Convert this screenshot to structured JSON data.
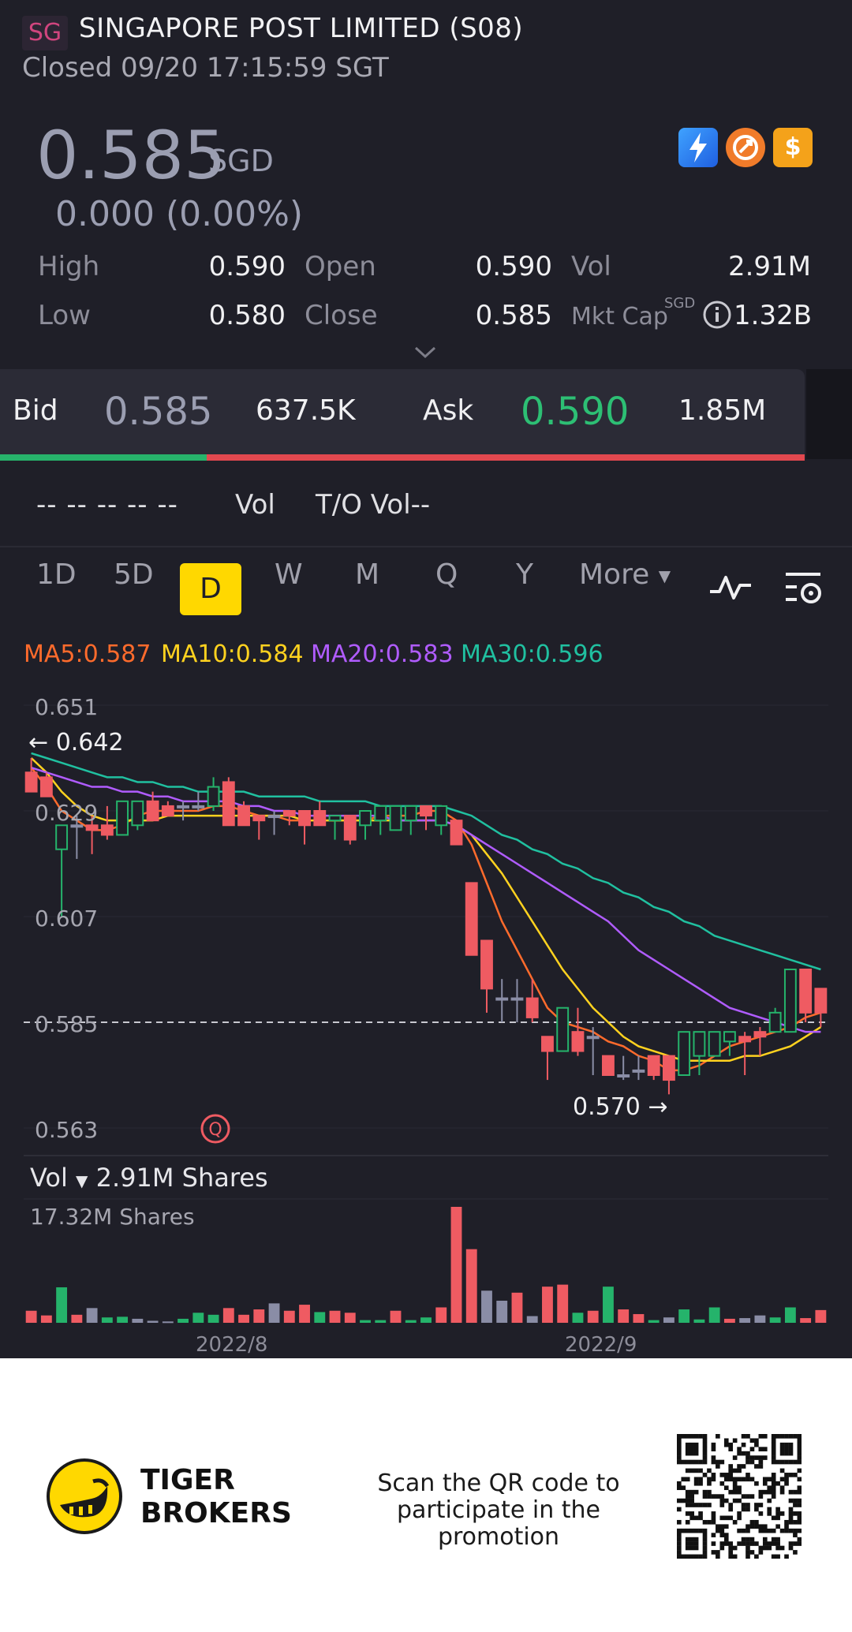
{
  "header": {
    "badge": "SG",
    "title": "SINGAPORE POST LIMITED (S08)",
    "status": "Closed 09/20 17:15:59 SGT"
  },
  "quote": {
    "price": "0.585",
    "currency": "SGD",
    "change": "0.000 (0.00%)",
    "badges": [
      "lightning-icon",
      "rocket-icon",
      "dollar-icon"
    ]
  },
  "stats": {
    "high_label": "High",
    "high": "0.590",
    "open_label": "Open",
    "open": "0.590",
    "vol_label": "Vol",
    "vol": "2.91M",
    "low_label": "Low",
    "low": "0.580",
    "close_label": "Close",
    "close": "0.585",
    "mktcap_label": "Mkt Cap",
    "mktcap_currency": "SGD",
    "mktcap": "1.32B"
  },
  "bidask": {
    "bid_label": "Bid",
    "bid": "0.585",
    "bid_size": "637.5K",
    "ask_label": "Ask",
    "ask": "0.590",
    "ask_size": "1.85M",
    "bid_fraction": 0.257
  },
  "volrow": {
    "placeholders": "-- -- -- -- --",
    "vol_label": "Vol",
    "to_vol_label": "T/O Vol--"
  },
  "timeframes": {
    "items": [
      "1D",
      "5D",
      "D",
      "W",
      "M",
      "Q",
      "Y"
    ],
    "active": "D",
    "more": "More"
  },
  "ma": {
    "ma5": "MA5:0.587",
    "ma10": "MA10:0.584",
    "ma20": "MA20:0.583",
    "ma30": "MA30:0.596",
    "colors": {
      "ma5": "#ff6b2c",
      "ma10": "#ffd21f",
      "ma20": "#b05cff",
      "ma30": "#20c0a0"
    }
  },
  "chart_annotations": {
    "max_label": "0.642",
    "min_label": "0.570",
    "volume_selector": "Vol",
    "volume_current": "2.91M Shares",
    "volume_max": "17.32M Shares"
  },
  "chart_data": {
    "type": "candlestick",
    "y_ticks": [
      "0.651",
      "0.629",
      "0.607",
      "0.585",
      "0.563"
    ],
    "ylim": [
      0.563,
      0.651
    ],
    "x_ticks": [
      "2022/8",
      "2022/9"
    ],
    "current_price_line": 0.585,
    "up_color": "#25b36b",
    "down_color": "#ef5b62",
    "flat_color": "#8a8da6",
    "candles": [
      {
        "o": 0.637,
        "h": 0.64,
        "l": 0.633,
        "c": 0.633
      },
      {
        "o": 0.636,
        "h": 0.637,
        "l": 0.632,
        "c": 0.632
      },
      {
        "o": 0.621,
        "h": 0.626,
        "l": 0.607,
        "c": 0.626
      },
      {
        "o": 0.626,
        "h": 0.628,
        "l": 0.619,
        "c": 0.626
      },
      {
        "o": 0.626,
        "h": 0.628,
        "l": 0.62,
        "c": 0.625
      },
      {
        "o": 0.626,
        "h": 0.63,
        "l": 0.623,
        "c": 0.624
      },
      {
        "o": 0.624,
        "h": 0.631,
        "l": 0.624,
        "c": 0.631
      },
      {
        "o": 0.626,
        "h": 0.631,
        "l": 0.625,
        "c": 0.631
      },
      {
        "o": 0.631,
        "h": 0.633,
        "l": 0.627,
        "c": 0.627
      },
      {
        "o": 0.63,
        "h": 0.631,
        "l": 0.628,
        "c": 0.628
      },
      {
        "o": 0.63,
        "h": 0.631,
        "l": 0.627,
        "c": 0.63
      },
      {
        "o": 0.63,
        "h": 0.633,
        "l": 0.629,
        "c": 0.63
      },
      {
        "o": 0.63,
        "h": 0.636,
        "l": 0.629,
        "c": 0.634
      },
      {
        "o": 0.635,
        "h": 0.636,
        "l": 0.626,
        "c": 0.626
      },
      {
        "o": 0.63,
        "h": 0.631,
        "l": 0.626,
        "c": 0.626
      },
      {
        "o": 0.628,
        "h": 0.628,
        "l": 0.623,
        "c": 0.627
      },
      {
        "o": 0.628,
        "h": 0.629,
        "l": 0.624,
        "c": 0.628
      },
      {
        "o": 0.629,
        "h": 0.629,
        "l": 0.626,
        "c": 0.628
      },
      {
        "o": 0.629,
        "h": 0.629,
        "l": 0.622,
        "c": 0.626
      },
      {
        "o": 0.629,
        "h": 0.631,
        "l": 0.626,
        "c": 0.626
      },
      {
        "o": 0.627,
        "h": 0.628,
        "l": 0.623,
        "c": 0.628
      },
      {
        "o": 0.628,
        "h": 0.628,
        "l": 0.622,
        "c": 0.623
      },
      {
        "o": 0.626,
        "h": 0.629,
        "l": 0.623,
        "c": 0.629
      },
      {
        "o": 0.627,
        "h": 0.63,
        "l": 0.624,
        "c": 0.63
      },
      {
        "o": 0.625,
        "h": 0.63,
        "l": 0.625,
        "c": 0.63
      },
      {
        "o": 0.627,
        "h": 0.63,
        "l": 0.624,
        "c": 0.63
      },
      {
        "o": 0.63,
        "h": 0.63,
        "l": 0.625,
        "c": 0.628
      },
      {
        "o": 0.626,
        "h": 0.63,
        "l": 0.624,
        "c": 0.63
      },
      {
        "o": 0.627,
        "h": 0.627,
        "l": 0.622,
        "c": 0.622
      },
      {
        "o": 0.614,
        "h": 0.614,
        "l": 0.599,
        "c": 0.599
      },
      {
        "o": 0.602,
        "h": 0.602,
        "l": 0.587,
        "c": 0.592
      },
      {
        "o": 0.59,
        "h": 0.594,
        "l": 0.585,
        "c": 0.59
      },
      {
        "o": 0.59,
        "h": 0.594,
        "l": 0.585,
        "c": 0.59
      },
      {
        "o": 0.59,
        "h": 0.594,
        "l": 0.585,
        "c": 0.586
      },
      {
        "o": 0.582,
        "h": 0.582,
        "l": 0.573,
        "c": 0.579
      },
      {
        "o": 0.579,
        "h": 0.588,
        "l": 0.579,
        "c": 0.588
      },
      {
        "o": 0.583,
        "h": 0.588,
        "l": 0.578,
        "c": 0.579
      },
      {
        "o": 0.582,
        "h": 0.584,
        "l": 0.574,
        "c": 0.582
      },
      {
        "o": 0.578,
        "h": 0.578,
        "l": 0.574,
        "c": 0.574
      },
      {
        "o": 0.574,
        "h": 0.578,
        "l": 0.573,
        "c": 0.574
      },
      {
        "o": 0.575,
        "h": 0.578,
        "l": 0.573,
        "c": 0.575
      },
      {
        "o": 0.578,
        "h": 0.578,
        "l": 0.573,
        "c": 0.574
      },
      {
        "o": 0.578,
        "h": 0.578,
        "l": 0.57,
        "c": 0.573
      },
      {
        "o": 0.574,
        "h": 0.583,
        "l": 0.574,
        "c": 0.583
      },
      {
        "o": 0.578,
        "h": 0.583,
        "l": 0.574,
        "c": 0.583
      },
      {
        "o": 0.578,
        "h": 0.583,
        "l": 0.578,
        "c": 0.583
      },
      {
        "o": 0.581,
        "h": 0.583,
        "l": 0.578,
        "c": 0.583
      },
      {
        "o": 0.582,
        "h": 0.583,
        "l": 0.574,
        "c": 0.581
      },
      {
        "o": 0.583,
        "h": 0.584,
        "l": 0.578,
        "c": 0.582
      },
      {
        "o": 0.583,
        "h": 0.588,
        "l": 0.583,
        "c": 0.587
      },
      {
        "o": 0.583,
        "h": 0.596,
        "l": 0.583,
        "c": 0.596
      },
      {
        "o": 0.596,
        "h": 0.596,
        "l": 0.585,
        "c": 0.587
      },
      {
        "o": 0.592,
        "h": 0.592,
        "l": 0.584,
        "c": 0.587
      }
    ],
    "ma_series": {
      "MA5": [
        0.638,
        0.634,
        0.629,
        0.627,
        0.625,
        0.625,
        0.626,
        0.628,
        0.629,
        0.629,
        0.629,
        0.629,
        0.63,
        0.63,
        0.629,
        0.628,
        0.628,
        0.627,
        0.627,
        0.627,
        0.627,
        0.627,
        0.627,
        0.628,
        0.628,
        0.628,
        0.629,
        0.629,
        0.627,
        0.622,
        0.614,
        0.606,
        0.6,
        0.594,
        0.588,
        0.585,
        0.584,
        0.583,
        0.581,
        0.58,
        0.578,
        0.577,
        0.575,
        0.575,
        0.576,
        0.578,
        0.58,
        0.581,
        0.582,
        0.583,
        0.584,
        0.586,
        0.587
      ],
      "MA10": [
        0.64,
        0.637,
        0.633,
        0.63,
        0.628,
        0.627,
        0.627,
        0.627,
        0.627,
        0.628,
        0.628,
        0.628,
        0.628,
        0.628,
        0.628,
        0.628,
        0.628,
        0.628,
        0.627,
        0.627,
        0.627,
        0.627,
        0.627,
        0.627,
        0.627,
        0.627,
        0.627,
        0.627,
        0.626,
        0.624,
        0.62,
        0.616,
        0.611,
        0.606,
        0.601,
        0.596,
        0.592,
        0.588,
        0.585,
        0.582,
        0.58,
        0.579,
        0.578,
        0.577,
        0.577,
        0.577,
        0.577,
        0.578,
        0.578,
        0.579,
        0.58,
        0.582,
        0.584
      ],
      "MA20": [
        0.638,
        0.637,
        0.636,
        0.635,
        0.634,
        0.634,
        0.633,
        0.633,
        0.632,
        0.632,
        0.631,
        0.631,
        0.631,
        0.631,
        0.63,
        0.63,
        0.629,
        0.629,
        0.628,
        0.628,
        0.628,
        0.628,
        0.628,
        0.628,
        0.627,
        0.627,
        0.627,
        0.627,
        0.626,
        0.624,
        0.622,
        0.62,
        0.618,
        0.616,
        0.614,
        0.612,
        0.61,
        0.608,
        0.606,
        0.603,
        0.6,
        0.598,
        0.596,
        0.594,
        0.592,
        0.59,
        0.588,
        0.587,
        0.586,
        0.585,
        0.584,
        0.583,
        0.583
      ],
      "MA30": [
        0.641,
        0.64,
        0.639,
        0.638,
        0.637,
        0.636,
        0.636,
        0.635,
        0.635,
        0.634,
        0.634,
        0.633,
        0.633,
        0.633,
        0.633,
        0.632,
        0.632,
        0.632,
        0.632,
        0.631,
        0.631,
        0.631,
        0.631,
        0.63,
        0.63,
        0.63,
        0.63,
        0.63,
        0.629,
        0.628,
        0.626,
        0.624,
        0.623,
        0.621,
        0.62,
        0.618,
        0.617,
        0.615,
        0.614,
        0.612,
        0.611,
        0.609,
        0.608,
        0.606,
        0.605,
        0.603,
        0.602,
        0.601,
        0.6,
        0.599,
        0.598,
        0.597,
        0.596
      ]
    },
    "volume": {
      "max": 17.32,
      "values": [
        1.8,
        1.1,
        5.3,
        1.2,
        2.2,
        0.8,
        0.9,
        0.6,
        0.3,
        0.2,
        0.6,
        1.5,
        1.2,
        2.2,
        1.2,
        2.0,
        2.9,
        1.8,
        2.7,
        1.6,
        1.8,
        1.5,
        0.4,
        0.4,
        1.8,
        0.4,
        0.8,
        2.3,
        17.32,
        11.0,
        4.8,
        3.3,
        4.5,
        1.0,
        5.4,
        5.7,
        1.5,
        1.8,
        5.4,
        2.0,
        1.3,
        0.4,
        0.8,
        2.0,
        0.5,
        2.3,
        0.6,
        0.7,
        1.1,
        0.8,
        2.3,
        0.7,
        1.9
      ],
      "colors": [
        "d",
        "d",
        "u",
        "d",
        "f",
        "u",
        "u",
        "f",
        "f",
        "f",
        "u",
        "u",
        "u",
        "d",
        "d",
        "d",
        "f",
        "d",
        "d",
        "u",
        "d",
        "d",
        "u",
        "u",
        "d",
        "u",
        "u",
        "d",
        "d",
        "d",
        "f",
        "f",
        "d",
        "f",
        "d",
        "d",
        "u",
        "d",
        "u",
        "d",
        "d",
        "u",
        "f",
        "u",
        "u",
        "u",
        "d",
        "f",
        "f",
        "u",
        "u",
        "d",
        "d"
      ]
    }
  },
  "footer": {
    "brand_line1": "TIGER",
    "brand_line2": "BROKERS",
    "promo_line1": "Scan the QR code to",
    "promo_line2": "participate in the promotion"
  }
}
